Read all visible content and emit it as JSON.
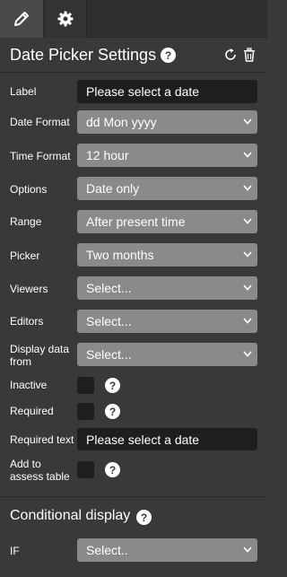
{
  "tabs": [
    {
      "icon": "pencil-icon",
      "active": true
    },
    {
      "icon": "gear-icon",
      "active": false
    }
  ],
  "header": {
    "title": "Date Picker Settings",
    "help": "?"
  },
  "fields": {
    "label": {
      "label": "Label",
      "value": "Please select a date"
    },
    "date_format": {
      "label": "Date Format",
      "value": "dd Mon yyyy"
    },
    "time_format": {
      "label": "Time Format",
      "value": "12 hour"
    },
    "options": {
      "label": "Options",
      "value": "Date only"
    },
    "range": {
      "label": "Range",
      "value": "After present time"
    },
    "picker": {
      "label": "Picker",
      "value": "Two months"
    },
    "viewers": {
      "label": "Viewers",
      "value": "Select..."
    },
    "editors": {
      "label": "Editors",
      "value": "Select..."
    },
    "display_data_from": {
      "label_line1": "Display data",
      "label_line2": "from",
      "value": "Select..."
    },
    "inactive": {
      "label": "Inactive",
      "checked": false,
      "help": "?"
    },
    "required": {
      "label": "Required",
      "checked": false,
      "help": "?"
    },
    "required_text": {
      "label": "Required text",
      "value": "Please select a date"
    },
    "add_to_assess_table": {
      "label_line1": "Add to",
      "label_line2": "assess table",
      "checked": false,
      "help": "?"
    }
  },
  "conditional": {
    "title": "Conditional display",
    "help": "?",
    "if_label": "IF",
    "if_value": "Select.."
  },
  "colors": {
    "panel": "#393939",
    "select": "#8a8a8a",
    "input": "#1e1e1e",
    "tabbar": "#2f2f2f"
  }
}
